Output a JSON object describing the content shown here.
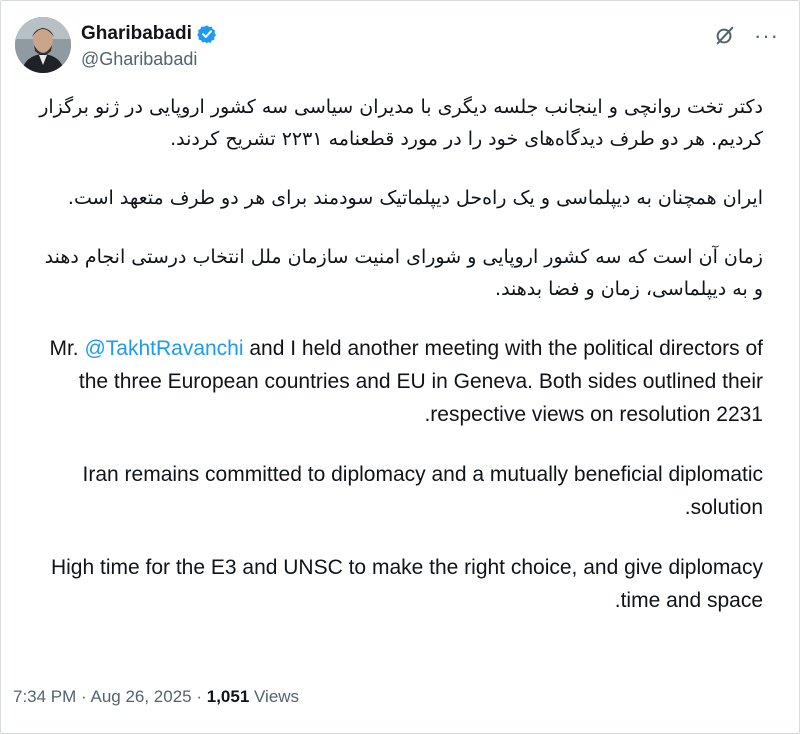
{
  "author": {
    "display_name": "Gharibabadi",
    "handle": "@Gharibabadi",
    "verified": true,
    "verified_color": "#1d9bf0",
    "avatar_icon": "profile-photo"
  },
  "actions": {
    "grok_icon": "grok-icon",
    "more_label": "···"
  },
  "post": {
    "fa_p1": "دکتر  تخت روانچی و اینجانب جلسه دیگری با مدیران سیاسی سه کشور اروپایی در ژنو برگزار کردیم. هر دو طرف دیدگاه‌های خود را در مورد قطعنامه ۲۲۳۱ تشریح کردند.",
    "fa_p2": "ایران همچنان به دیپلماسی و یک راه‌حل دیپلماتیک سودمند برای هر دو طرف متعهد است.",
    "fa_p3": "زمان آن است که سه کشور اروپایی و شورای امنیت سازمان ملل انتخاب درستی انجام دهند و به دیپلماسی، زمان و فضا بدهند.",
    "en_p1_prefix": "Mr. ",
    "en_p1_mention": "@TakhtRavanchi",
    "en_p1_rest": " and I held another meeting with the political directors of the three European countries and EU in Geneva. Both sides outlined their respective views on resolution 2231.",
    "en_p2": "Iran remains committed to diplomacy and a mutually beneficial diplomatic solution.",
    "en_p3": "High time for the E3 and UNSC to make the right choice, and give diplomacy time and space."
  },
  "meta": {
    "time": "7:34 PM",
    "date": "Aug 26, 2025",
    "separator": " · ",
    "views_count": "1,051",
    "views_label": " Views"
  }
}
